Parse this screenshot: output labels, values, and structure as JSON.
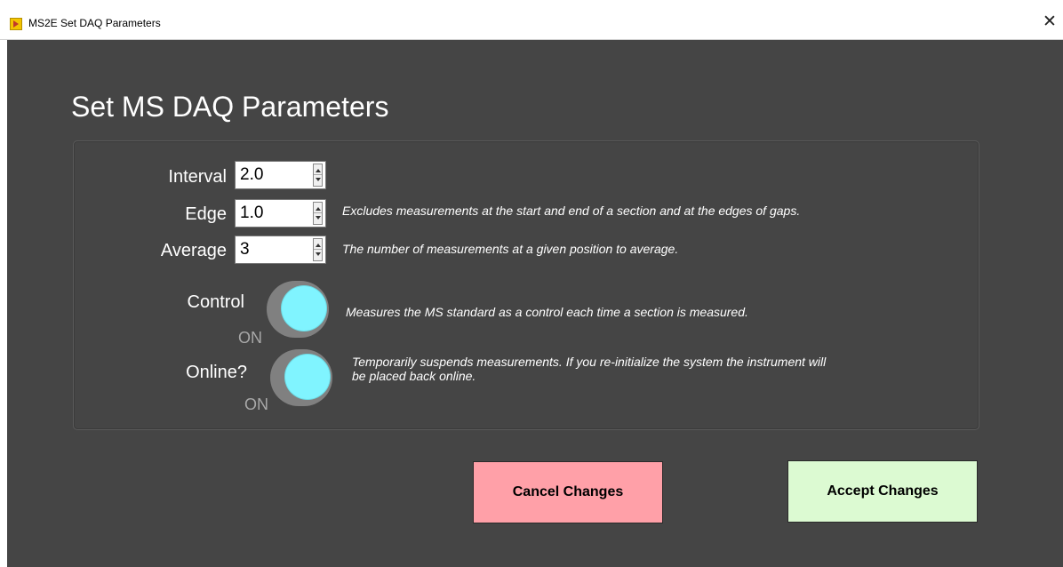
{
  "window": {
    "title": "MS2E Set DAQ Parameters",
    "close_glyph": "✕",
    "icon": "labview-app-icon"
  },
  "heading": "Set MS DAQ Parameters",
  "fields": {
    "interval": {
      "label": "Interval",
      "value": "2.0"
    },
    "edge": {
      "label": "Edge",
      "value": "1.0",
      "description": "Excludes measurements at the start and end of a section and at the edges of gaps."
    },
    "average": {
      "label": "Average",
      "value": "3",
      "description": "The number of measurements at a given position to average."
    }
  },
  "toggles": {
    "control": {
      "label": "Control",
      "state": "ON",
      "description": "Measures the MS standard as a control each time a section is measured."
    },
    "online": {
      "label": "Online?",
      "state": "ON",
      "description_line1": "Temporarily suspends measurements. If you re-initialize the system the instrument will",
      "description_line2": "be placed back online."
    }
  },
  "buttons": {
    "cancel": "Cancel Changes",
    "accept": "Accept Changes"
  },
  "colors": {
    "background": "#454545",
    "toggle_on": "#80f4ff",
    "cancel": "#ffa0a8",
    "accept": "#dcfad2"
  }
}
